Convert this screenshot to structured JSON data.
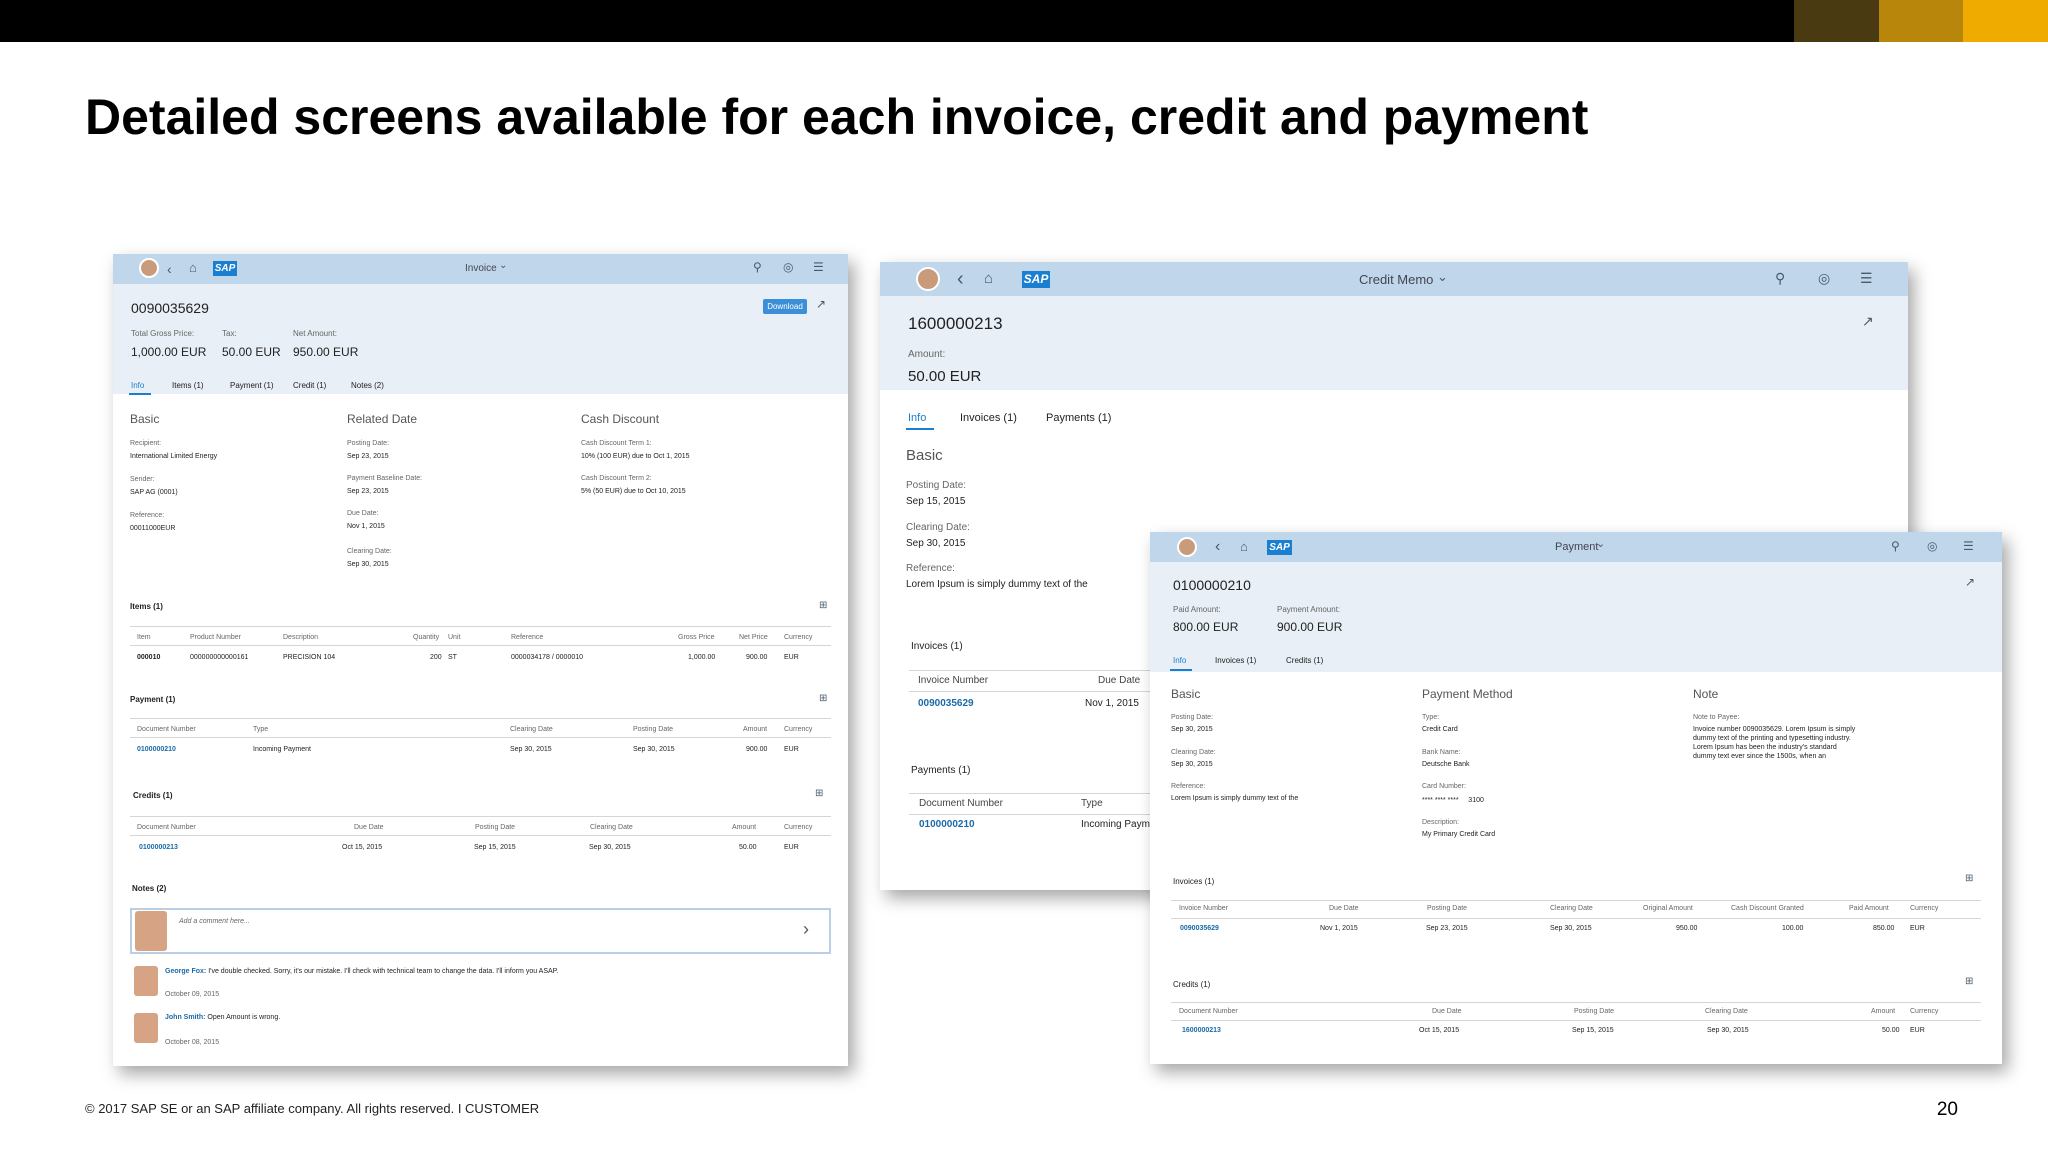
{
  "slide": {
    "title": "Detailed screens available for each invoice, credit and payment",
    "footer": "© 2017 SAP SE or an SAP affiliate company. All rights reserved.  I  CUSTOMER",
    "page": "20",
    "colors": {
      "bar": "#000000",
      "accent1": "#4a3a12",
      "accent2": "#b8860b",
      "accent3": "#f0ab00"
    }
  },
  "invoice": {
    "shell_title": "Invoice",
    "logo": "SAP",
    "id": "0090035629",
    "download": "Download",
    "kpis": [
      {
        "label": "Total Gross Price:",
        "value": "1,000.00 EUR"
      },
      {
        "label": "Tax:",
        "value": "50.00 EUR"
      },
      {
        "label": "Net Amount:",
        "value": "950.00 EUR"
      }
    ],
    "tabs": [
      "Info",
      "Items (1)",
      "Payment (1)",
      "Credit (1)",
      "Notes (2)"
    ],
    "basic": {
      "title": "Basic",
      "f": [
        [
          "Recipient:",
          "International Limited Energy"
        ],
        [
          "Sender:",
          "SAP AG (0001)"
        ],
        [
          "Reference:",
          "00011000EUR"
        ]
      ]
    },
    "related": {
      "title": "Related Date",
      "f": [
        [
          "Posting Date:",
          "Sep 23, 2015"
        ],
        [
          "Payment Baseline Date:",
          "Sep 23, 2015"
        ],
        [
          "Due Date:",
          "Nov 1, 2015"
        ],
        [
          "Clearing Date:",
          "Sep 30, 2015"
        ]
      ]
    },
    "cash": {
      "title": "Cash Discount",
      "f": [
        [
          "Cash Discount Term 1:",
          "10% (100 EUR) due to Oct 1, 2015"
        ],
        [
          "Cash Discount Term 2:",
          "5% (50 EUR) due to Oct 10, 2015"
        ]
      ]
    },
    "items": {
      "title": "Items (1)",
      "cols": [
        "Item",
        "Product Number",
        "Description",
        "Quantity",
        "Unit",
        "Reference",
        "Gross Price",
        "Net Price",
        "Currency"
      ],
      "row": [
        "000010",
        "000000000000161",
        "PRECISION 104",
        "200",
        "ST",
        "0000034178 / 0000010",
        "1,000.00",
        "900.00",
        "EUR"
      ]
    },
    "payment": {
      "title": "Payment (1)",
      "cols": [
        "Document Number",
        "Type",
        "Clearing Date",
        "Posting Date",
        "Amount",
        "Currency"
      ],
      "row": [
        "0100000210",
        "Incoming Payment",
        "Sep 30, 2015",
        "Sep 30, 2015",
        "900.00",
        "EUR"
      ]
    },
    "credits": {
      "title": "Credits (1)",
      "cols": [
        "Document Number",
        "Due Date",
        "Posting Date",
        "Clearing Date",
        "Amount",
        "Currency"
      ],
      "row": [
        "0100000213",
        "Oct 15, 2015",
        "Sep 15, 2015",
        "Sep 30, 2015",
        "50.00",
        "EUR"
      ]
    },
    "notes": {
      "title": "Notes (2)",
      "placeholder": "Add a comment here...",
      "c1name": "George Fox:",
      "c1text": "I've double checked. Sorry, it's our mistake. I'll check with technical team to change the data.  I'll inform you ASAP.",
      "c1date": "October 09, 2015",
      "c2name": "John Smith:",
      "c2text": "Open Amount is wrong.",
      "c2date": "October 08, 2015"
    }
  },
  "credit": {
    "shell_title": "Credit Memo",
    "logo": "SAP",
    "id": "1600000213",
    "amount_label": "Amount:",
    "amount": "50.00 EUR",
    "tabs": [
      "Info",
      "Invoices (1)",
      "Payments (1)"
    ],
    "basic_title": "Basic",
    "f": [
      [
        "Posting Date:",
        "Sep 15, 2015"
      ],
      [
        "Clearing Date:",
        "Sep 30, 2015"
      ],
      [
        "Reference:",
        "Lorem Ipsum is simply dummy text of the"
      ]
    ],
    "invoices": {
      "title": "Invoices (1)",
      "cols": [
        "Invoice Number",
        "Due Date"
      ],
      "row": [
        "0090035629",
        "Nov 1, 2015"
      ]
    },
    "payments": {
      "title": "Payments (1)",
      "cols": [
        "Document Number",
        "Type"
      ],
      "row": [
        "0100000210",
        "Incoming Paym"
      ]
    }
  },
  "payment": {
    "shell_title": "Payment",
    "logo": "SAP",
    "id": "0100000210",
    "kpis": [
      {
        "label": "Paid Amount:",
        "value": "800.00 EUR"
      },
      {
        "label": "Payment Amount:",
        "value": "900.00 EUR"
      }
    ],
    "tabs": [
      "Info",
      "Invoices (1)",
      "Credits (1)"
    ],
    "basic": {
      "title": "Basic",
      "f": [
        [
          "Posting Date:",
          "Sep 30, 2015"
        ],
        [
          "Clearing Date:",
          "Sep 30, 2015"
        ],
        [
          "Reference:",
          "Lorem Ipsum is simply dummy text of the"
        ]
      ]
    },
    "method": {
      "title": "Payment Method",
      "f": [
        [
          "Type:",
          "Credit Card"
        ],
        [
          "Bank Name:",
          "Deutsche Bank"
        ],
        [
          "Card Number:",
          "**** **** ****     3100"
        ],
        [
          "Description:",
          "My Primary Credit Card"
        ]
      ]
    },
    "note": {
      "title": "Note",
      "label": "Note to Payee:",
      "l1": "Invoice number 0090035629. Lorem Ipsum is simply",
      "l2": "dummy text of the printing and typesetting industry.",
      "l3": "Lorem Ipsum has been the industry's standard",
      "l4": "dummy text ever since the 1500s, when an"
    },
    "invoices": {
      "title": "Invoices (1)",
      "cols": [
        "Invoice Number",
        "Due Date",
        "Posting Date",
        "Clearing Date",
        "Original Amount",
        "Cash Discount Granted",
        "Paid Amount",
        "Currency"
      ],
      "row": [
        "0090035629",
        "Nov 1, 2015",
        "Sep 23, 2015",
        "Sep 30, 2015",
        "950.00",
        "100.00",
        "850.00",
        "EUR"
      ]
    },
    "credits": {
      "title": "Credits (1)",
      "cols": [
        "Document Number",
        "Due Date",
        "Posting Date",
        "Clearing Date",
        "Amount",
        "Currency"
      ],
      "row": [
        "1600000213",
        "Oct 15, 2015",
        "Sep 15, 2015",
        "Sep 30, 2015",
        "50.00",
        "EUR"
      ]
    }
  }
}
